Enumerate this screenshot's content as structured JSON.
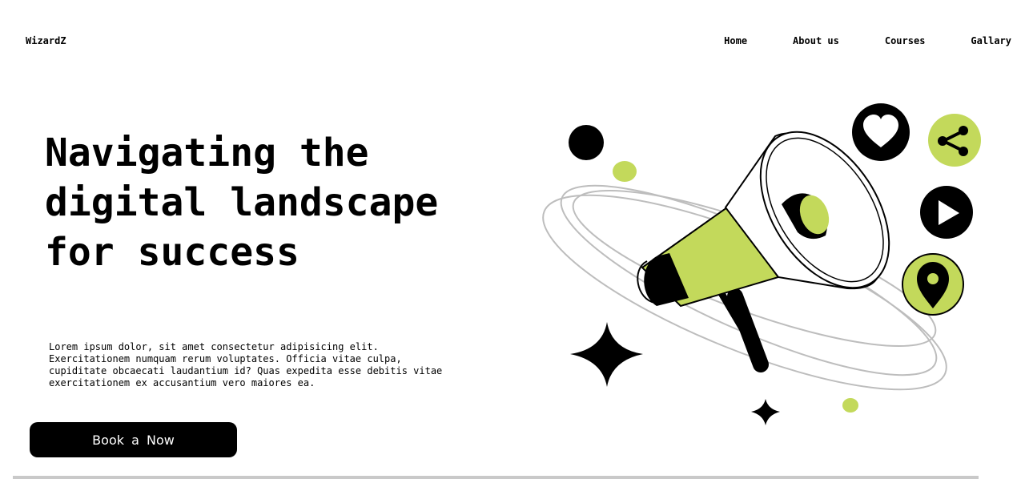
{
  "brand": {
    "name": "WizardZ"
  },
  "nav": {
    "items": [
      {
        "label": "Home"
      },
      {
        "label": "About us"
      },
      {
        "label": "Courses"
      },
      {
        "label": "Gallary"
      }
    ]
  },
  "hero": {
    "title": "Navigating the digital landscape for success",
    "description": "Lorem ipsum dolor, sit amet consectetur adipisicing elit. Exercitationem numquam rerum voluptates. Officia vitae culpa, cupiditate obcaecati laudantium id? Quas expedita esse debitis vitae exercitationem ex accusantium vero maiores ea.",
    "cta_label": "Book a Now"
  },
  "illustration": {
    "accent_color": "#c3d95b",
    "ink_color": "#000000",
    "icons": [
      "megaphone-icon",
      "heart-icon",
      "share-icon",
      "play-icon",
      "location-pin-icon",
      "sparkle-star-icon"
    ]
  }
}
